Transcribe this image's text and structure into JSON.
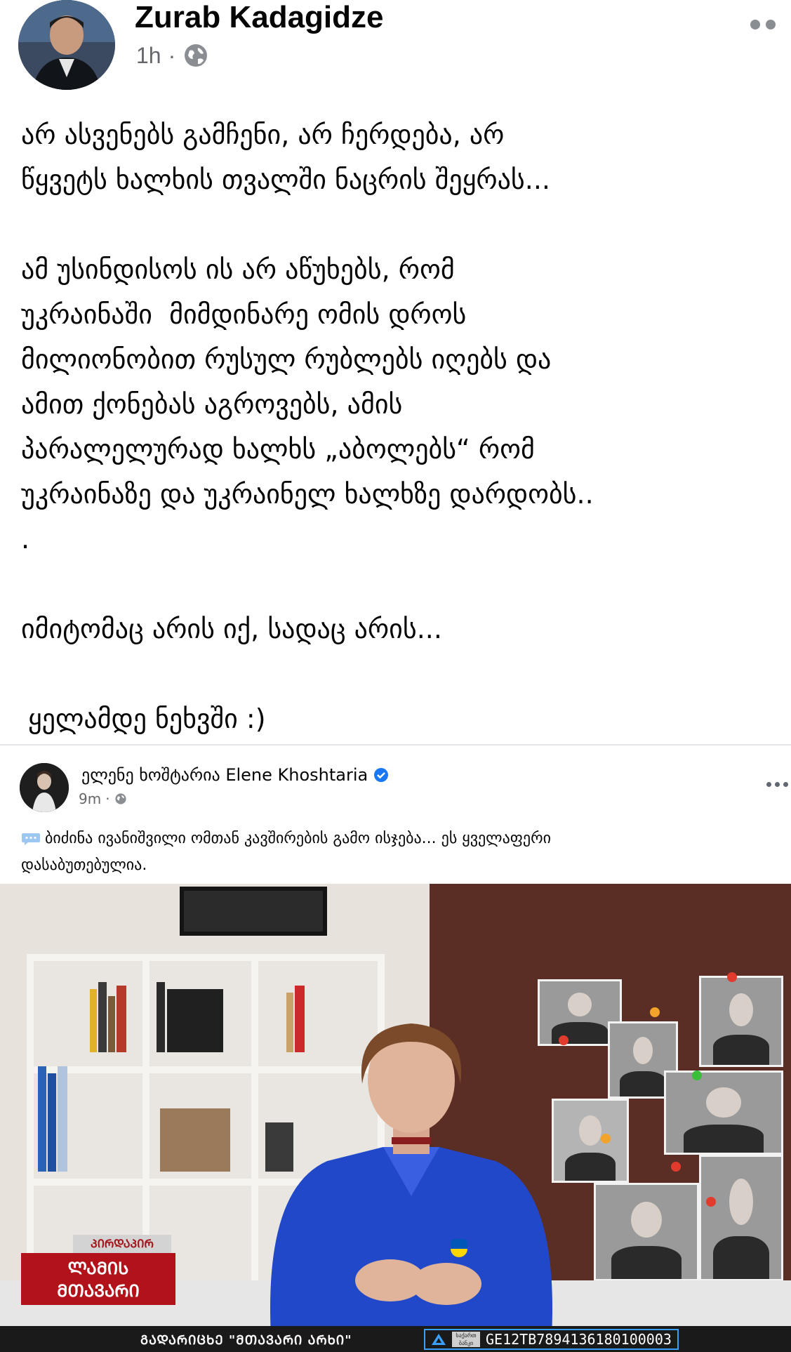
{
  "post": {
    "author": "Zurab Kadagidze",
    "time": "1h",
    "dot": "·",
    "audience_icon": "globe-icon",
    "more_icon": "more-options-icon",
    "paragraphs": [
      "არ ასვენებს გამჩენი, არ ჩერდება, არ\nწყვეტს ხალხის თვალში ნაცრის შეყრას...",
      "ამ უსინდისოს ის არ აწუხებს, რომ\nუკრაინაში  მიმდინარე ომის დროს\nმილიონობით რუსულ რუბლებს იღებს და\nამით ქონებას აგროვებს, ამის\nპარალელურად ხალხს „აბოლებს“ რომ\nუკრაინაზე და უკრაინელ ხალხზე დარდობს..\n.",
      "იმიტომაც არის იქ, სადაც არის...",
      "ყელამდე ნეხვში :)"
    ]
  },
  "shared_post": {
    "author": "ელენე ხოშტარია Elene Khoshtaria",
    "time": "9m",
    "dot": "·",
    "audience_icon": "globe-icon",
    "verified_icon": "verified-badge-icon",
    "text": "ბიძინა ივანიშვილი ომთან კავშირების გამო ისჯება... ეს ყველაფერი\nდასაბუთებულია.",
    "video": {
      "show_logo_top": "ᲞᲘᲠᲓᲐᲞᲘᲠ",
      "show_logo_main": "ᲚᲐᲛᲘᲡ\nᲛᲗᲐᲕᲐᲠᲘ",
      "ticker_text": "ᲒᲐᲓᲐᲠᲘᲪᲮᲔ \"ᲛᲗᲐᲕᲐᲠᲘ ᲐᲠᲮᲘ\"",
      "bank_label": "საქართ\nბანკი",
      "account_number": "GE12TB7894136180100003"
    }
  },
  "colors": {
    "secondary_text": "#65676b",
    "verified_blue": "#1877f2",
    "logo_red": "#b2121a"
  }
}
